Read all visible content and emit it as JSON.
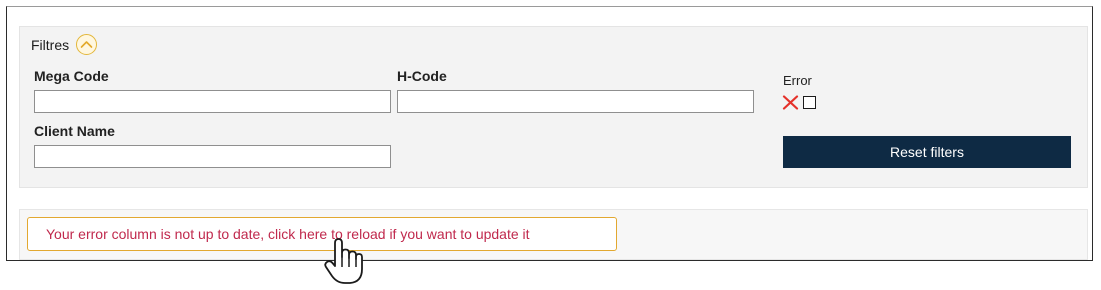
{
  "filters": {
    "title": "Filtres",
    "toggle_icon": "chevron-up-icon",
    "mega_code": {
      "label": "Mega Code",
      "value": "",
      "placeholder": ""
    },
    "h_code": {
      "label": "H-Code",
      "value": "",
      "placeholder": ""
    },
    "client_name": {
      "label": "Client Name",
      "value": "",
      "placeholder": ""
    },
    "error": {
      "label": "Error",
      "clear_icon": "x-icon",
      "checked": false
    },
    "reset_label": "Reset filters"
  },
  "notice": {
    "text": "Your error column is not up to date, click here to reload if you want to update it"
  },
  "colors": {
    "accent_orange": "#e2a830",
    "notice_text": "#c0294d",
    "button_bg": "#0e2a44",
    "clear_x": "#e5312a"
  },
  "cursor": {
    "icon": "hand-pointer-icon"
  }
}
